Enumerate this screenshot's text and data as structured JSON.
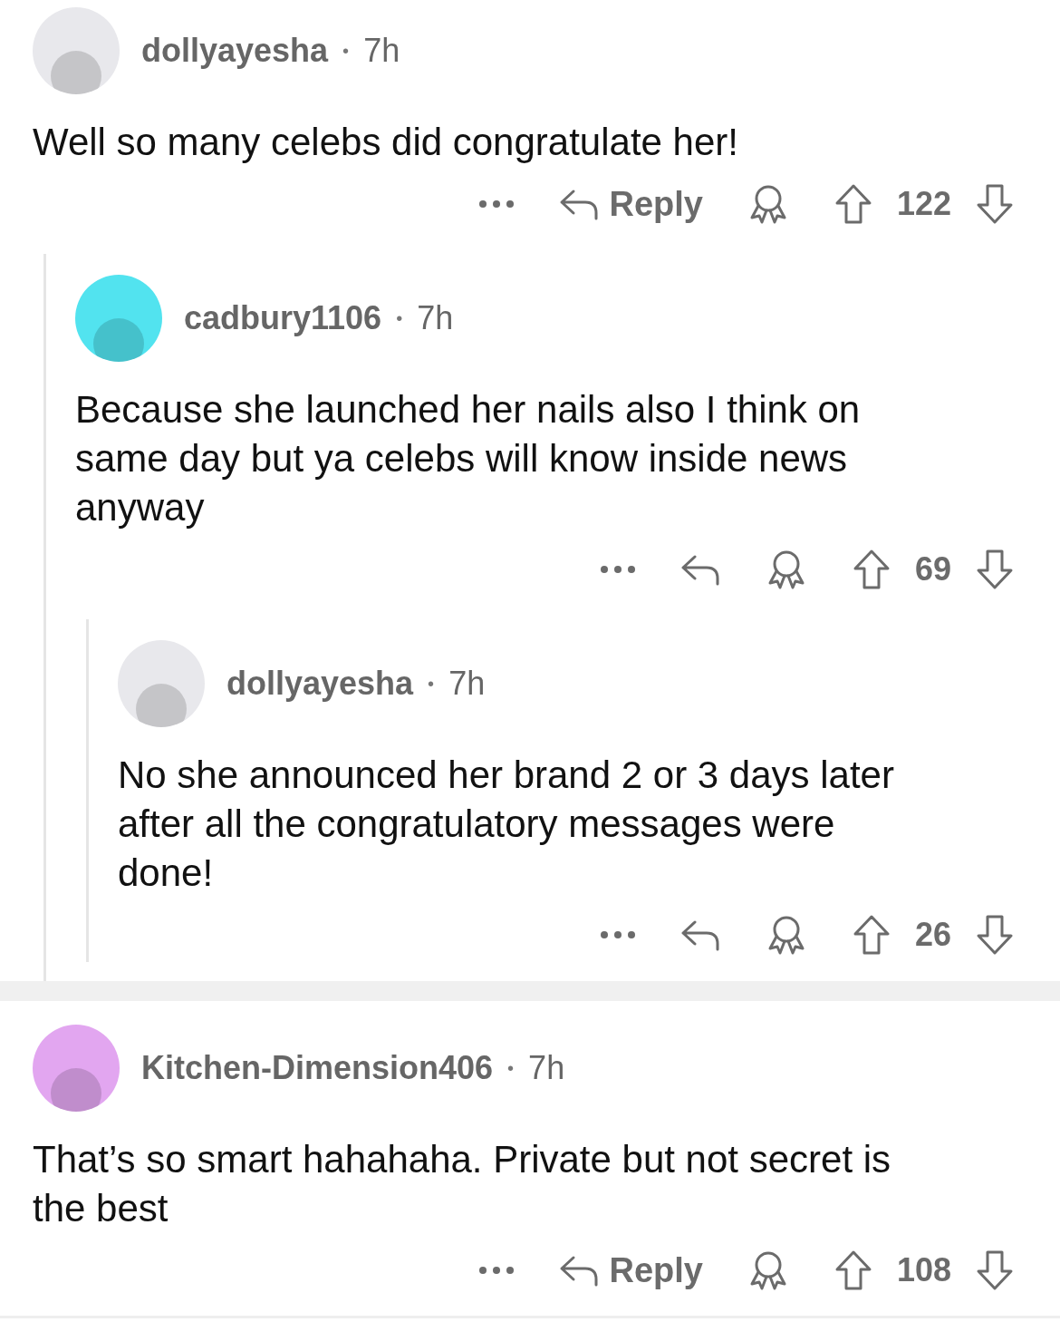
{
  "comments": [
    {
      "username": "dollyayesha",
      "dot": "•",
      "time": "7h",
      "color": "#e8e8ec",
      "body": "Well so many celebs did congratulate her!",
      "reply_label": "Reply",
      "score": "122",
      "children": [
        {
          "username": "cadbury1106",
          "dot": "•",
          "time": "7h",
          "color": "#52e3ef",
          "body": "Because she launched her nails also I think on same day but ya celebs will know inside news anyway",
          "score": "69",
          "children": [
            {
              "username": "dollyayesha",
              "dot": "•",
              "time": "7h",
              "color": "#e8e8ec",
              "body": "No she announced her brand 2 or 3 days later after all the congratulatory messages were done!",
              "score": "26"
            }
          ]
        }
      ]
    },
    {
      "username": "Kitchen-Dimension406",
      "dot": "•",
      "time": "7h",
      "color": "#e2a6f0",
      "body": "That’s so smart hahahaha. Private but not secret is the best",
      "reply_label": "Reply",
      "score": "108"
    }
  ]
}
